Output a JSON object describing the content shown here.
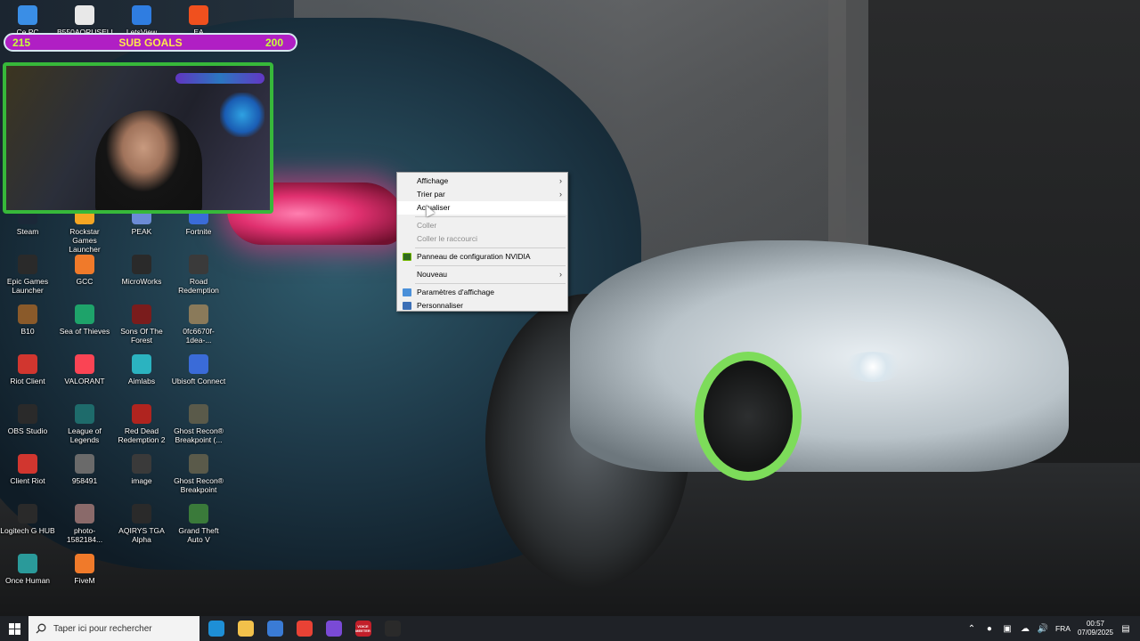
{
  "overlay": {
    "subgoal": {
      "left_value": "215",
      "title": "SUB GOALS",
      "right_value": "200"
    }
  },
  "desktop_icons": [
    {
      "label": "Ce PC",
      "icon": "computer-icon",
      "color": "#3a8ee6"
    },
    {
      "label": "B550AORUSELI...",
      "icon": "file-icon",
      "color": "#e8e8e8"
    },
    {
      "label": "LetsView",
      "icon": "letsview-icon",
      "color": "#2f7de1"
    },
    {
      "label": "EA",
      "icon": "ea-icon",
      "color": "#f0501e"
    },
    {
      "label": "Steam",
      "icon": "steam-icon",
      "color": "#1b2838"
    },
    {
      "label": "Rockstar Games Launcher",
      "icon": "rockstar-icon",
      "color": "#f5a623"
    },
    {
      "label": "PEAK",
      "icon": "peak-icon",
      "color": "#6b8bd6"
    },
    {
      "label": "Fortnite",
      "icon": "fortnite-icon",
      "color": "#3a6bd8"
    },
    {
      "label": "Epic Games Launcher",
      "icon": "epic-games-icon",
      "color": "#2a2a2a"
    },
    {
      "label": "GCC",
      "icon": "gcc-icon",
      "color": "#f07a2a"
    },
    {
      "label": "MicroWorks",
      "icon": "microworks-icon",
      "color": "#2a2a2a"
    },
    {
      "label": "Road Redemption",
      "icon": "road-redemption-icon",
      "color": "#3a3a3a"
    },
    {
      "label": "B10",
      "icon": "b10-icon",
      "color": "#8a5a2a"
    },
    {
      "label": "Sea of Thieves",
      "icon": "sea-of-thieves-icon",
      "color": "#1ea36a"
    },
    {
      "label": "Sons Of The Forest",
      "icon": "sons-of-the-forest-icon",
      "color": "#7a1c1c"
    },
    {
      "label": "0fc6670f-1dea-...",
      "icon": "image-file-icon",
      "color": "#8a7a5a"
    },
    {
      "label": "Riot Client",
      "icon": "riot-client-icon",
      "color": "#d1362f"
    },
    {
      "label": "VALORANT",
      "icon": "valorant-icon",
      "color": "#fa4454"
    },
    {
      "label": "Aimlabs",
      "icon": "aimlabs-icon",
      "color": "#2bb3c0"
    },
    {
      "label": "Ubisoft Connect",
      "icon": "ubisoft-connect-icon",
      "color": "#3a6bd8"
    },
    {
      "label": "OBS Studio",
      "icon": "obs-icon",
      "color": "#2a2a2a"
    },
    {
      "label": "League of Legends",
      "icon": "league-of-legends-icon",
      "color": "#1e6b6b"
    },
    {
      "label": "Red Dead Redemption 2",
      "icon": "rdr2-icon",
      "color": "#b0241f"
    },
    {
      "label": "Ghost Recon® Breakpoint (...",
      "icon": "ghost-recon-icon",
      "color": "#5a5a4a"
    },
    {
      "label": "Client Riot",
      "icon": "riot-client-icon",
      "color": "#d1362f"
    },
    {
      "label": "958491",
      "icon": "image-file-icon",
      "color": "#6a6a6a"
    },
    {
      "label": "image",
      "icon": "image-file-icon",
      "color": "#3a3a3a"
    },
    {
      "label": "Ghost Recon® Breakpoint",
      "icon": "ghost-recon-icon",
      "color": "#5a5a4a"
    },
    {
      "label": "Logitech G HUB",
      "icon": "logitech-icon",
      "color": "#2a2a2a"
    },
    {
      "label": "photo-1582184...",
      "icon": "image-file-icon",
      "color": "#8a6a6a"
    },
    {
      "label": "AQIRYS TGA Alpha",
      "icon": "aqirys-icon",
      "color": "#2a2a2a"
    },
    {
      "label": "Grand Theft Auto V",
      "icon": "gta-icon",
      "color": "#3a7a3a"
    },
    {
      "label": "Once Human",
      "icon": "once-human-icon",
      "color": "#2a9a9a"
    },
    {
      "label": "FiveM",
      "icon": "fivem-icon",
      "color": "#f07a2a"
    }
  ],
  "context_menu": {
    "items": [
      {
        "label": "Affichage",
        "submenu": true
      },
      {
        "label": "Trier par",
        "submenu": true
      },
      {
        "label": "Actualiser",
        "hover": true
      },
      {
        "label": "Coller",
        "disabled": true
      },
      {
        "label": "Coller le raccourci",
        "disabled": true
      },
      {
        "label": "Panneau de configuration NVIDIA",
        "icon": "nvidia-icon"
      },
      {
        "label": "Nouveau",
        "submenu": true
      },
      {
        "label": "Paramètres d'affichage",
        "icon": "display-settings-icon"
      },
      {
        "label": "Personnaliser",
        "icon": "personalize-icon"
      }
    ]
  },
  "taskbar": {
    "search_placeholder": "Taper ici pour rechercher",
    "apps": [
      {
        "name": "edge-icon",
        "color": "#1e8fd6"
      },
      {
        "name": "file-explorer-icon",
        "color": "#f2c14b"
      },
      {
        "name": "store-icon",
        "color": "#3a7bd5"
      },
      {
        "name": "chrome-icon",
        "color": "#e94235"
      },
      {
        "name": "app-purple-icon",
        "color": "#7a4ad6"
      },
      {
        "name": "voice-meeter-icon",
        "color": "#c21f2a",
        "text": "VOICE MEETER"
      },
      {
        "name": "obs-taskbar-icon",
        "color": "#2a2a2a"
      }
    ],
    "language": "FRA",
    "time": "00:57",
    "date": "07/09/2025"
  }
}
